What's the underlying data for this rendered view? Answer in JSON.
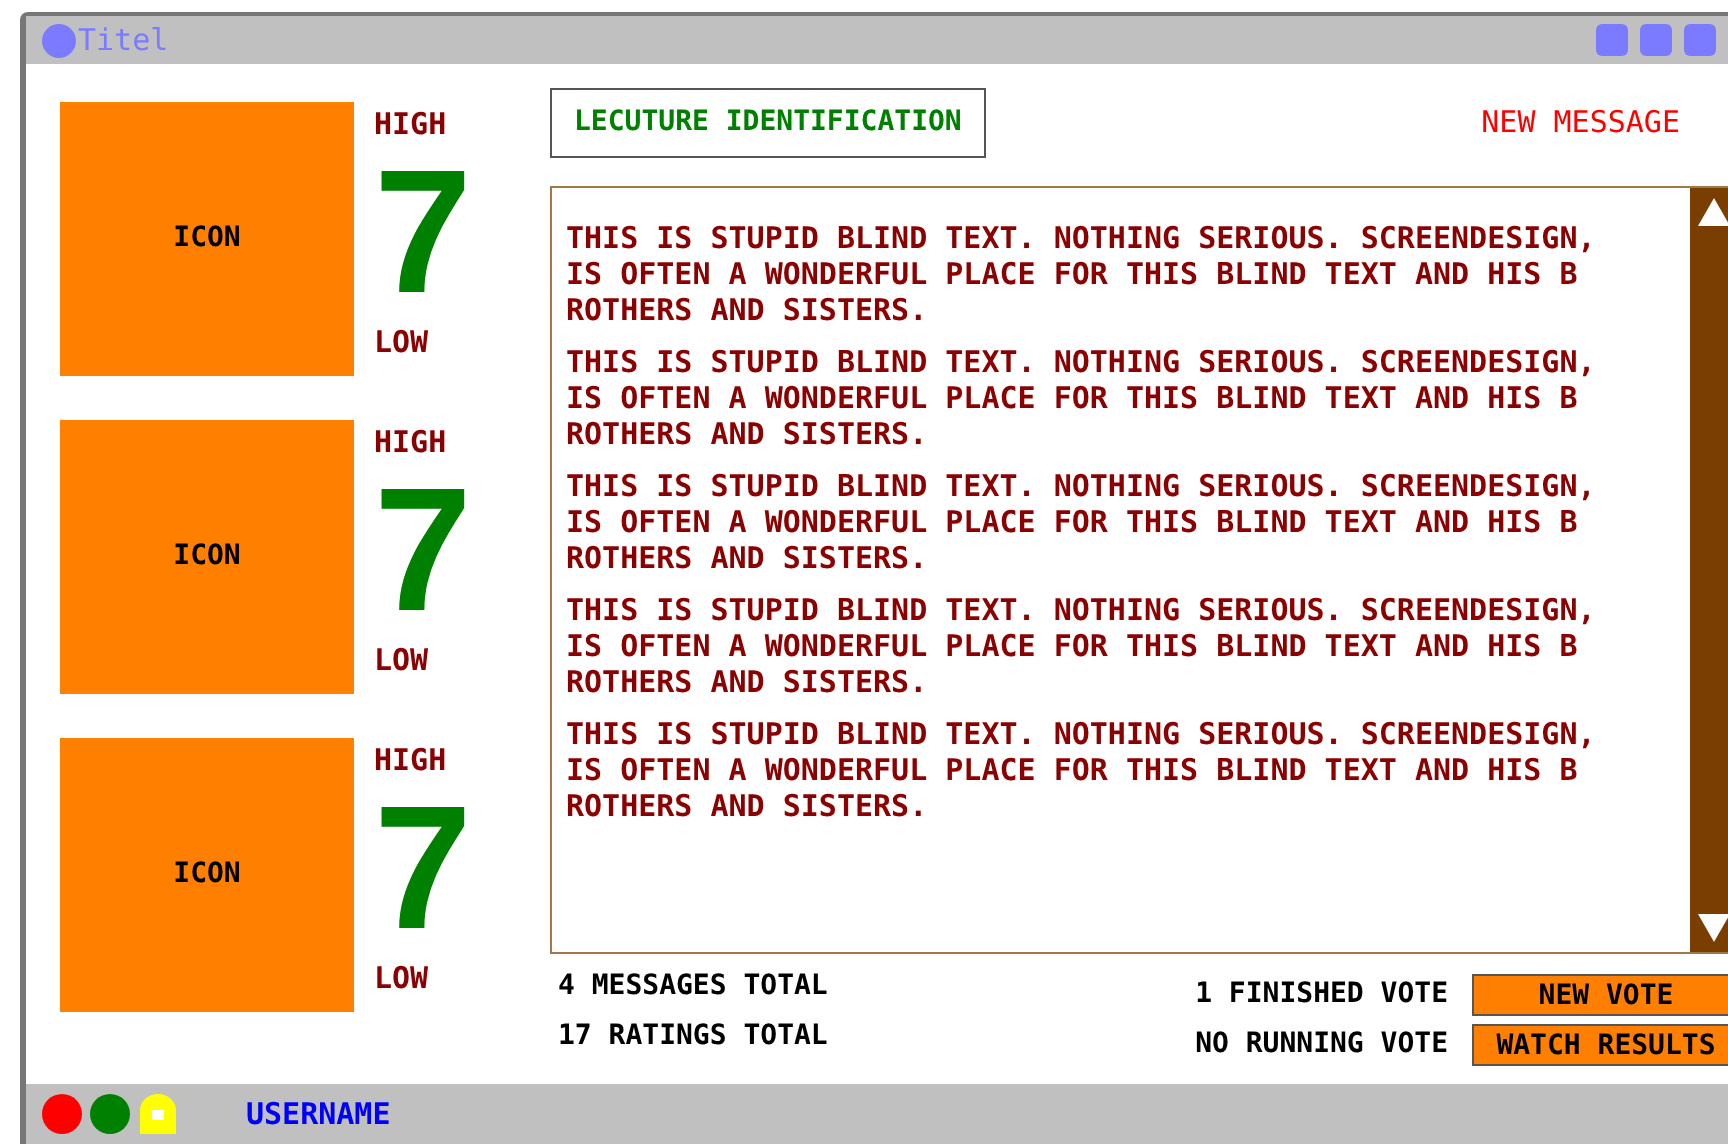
{
  "window": {
    "title": "Titel"
  },
  "ratings": [
    {
      "icon": "ICON",
      "high": "HIGH",
      "value": "7",
      "low": "LOW"
    },
    {
      "icon": "ICON",
      "high": "HIGH",
      "value": "7",
      "low": "LOW"
    },
    {
      "icon": "ICON",
      "high": "HIGH",
      "value": "7",
      "low": "LOW"
    }
  ],
  "lecture_button": "LECUTURE IDENTIFICATION",
  "new_message": "NEW MESSAGE",
  "messages": [
    {
      "lines": [
        "THIS IS STUPID BLIND TEXT. NOTHING SERIOUS. SCREENDESIGN,",
        "IS OFTEN A WONDERFUL PLACE FOR THIS BLIND TEXT AND HIS B",
        "ROTHERS AND SISTERS."
      ]
    },
    {
      "lines": [
        "THIS IS STUPID BLIND TEXT. NOTHING SERIOUS. SCREENDESIGN,",
        "IS OFTEN A WONDERFUL PLACE FOR THIS BLIND TEXT AND HIS B",
        "ROTHERS AND SISTERS."
      ]
    },
    {
      "lines": [
        "THIS IS STUPID BLIND TEXT. NOTHING SERIOUS. SCREENDESIGN,",
        "IS OFTEN A WONDERFUL PLACE FOR THIS BLIND TEXT AND HIS B",
        "ROTHERS AND SISTERS."
      ]
    },
    {
      "lines": [
        "THIS IS STUPID BLIND TEXT. NOTHING SERIOUS. SCREENDESIGN,",
        "IS OFTEN A WONDERFUL PLACE FOR THIS BLIND TEXT AND HIS B",
        "ROTHERS AND SISTERS."
      ]
    },
    {
      "lines": [
        "THIS IS STUPID BLIND TEXT. NOTHING SERIOUS. SCREENDESIGN,",
        "IS OFTEN A WONDERFUL PLACE FOR THIS BLIND TEXT AND HIS B",
        "ROTHERS AND SISTERS."
      ]
    }
  ],
  "stats": [
    "4 MESSAGES TOTAL",
    "17 RATINGS TOTAL"
  ],
  "votes": [
    {
      "label": "1 FINISHED VOTE",
      "button": "NEW VOTE"
    },
    {
      "label": "NO RUNNING VOTE",
      "button": "WATCH RESULTS"
    }
  ],
  "status_bar": {
    "username": "USERNAME"
  }
}
